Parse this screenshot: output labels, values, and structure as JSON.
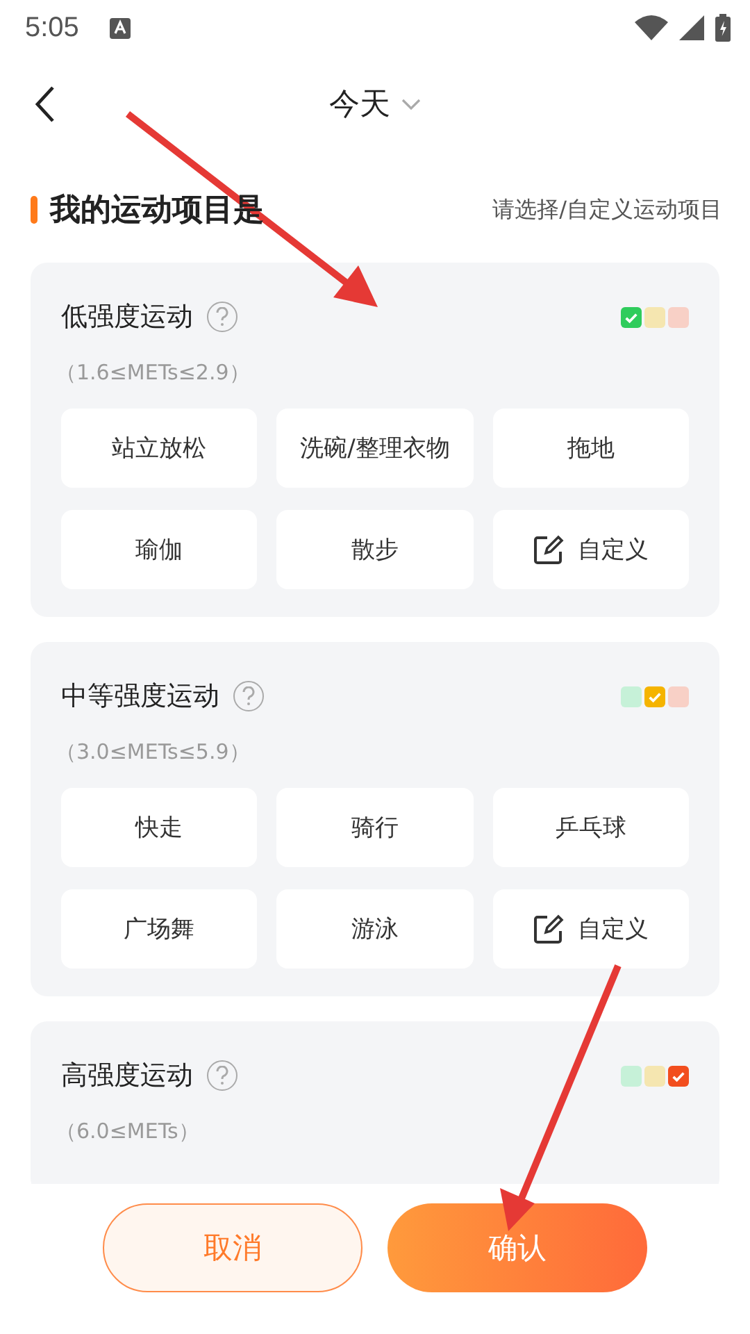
{
  "status_bar": {
    "time": "5:05"
  },
  "header": {
    "title": "今天"
  },
  "section": {
    "title": "我的运动项目是",
    "hint": "请选择/自定义运动项目"
  },
  "groups": [
    {
      "title": "低强度运动",
      "range": "（1.6≤METs≤2.9）",
      "levels": [
        {
          "color": "#2fcc5c",
          "selected": true
        },
        {
          "color": "#f5e6b0",
          "selected": false
        },
        {
          "color": "#f8d0c6",
          "selected": false
        }
      ],
      "items": [
        {
          "kind": "activity",
          "label": "站立放松"
        },
        {
          "kind": "activity",
          "label": "洗碗/整理衣物"
        },
        {
          "kind": "activity",
          "label": "拖地"
        },
        {
          "kind": "activity",
          "label": "瑜伽"
        },
        {
          "kind": "activity",
          "label": "散步"
        },
        {
          "kind": "custom",
          "label": "自定义"
        }
      ]
    },
    {
      "title": "中等强度运动",
      "range": "（3.0≤METs≤5.9）",
      "levels": [
        {
          "color": "#c6f1d8",
          "selected": false
        },
        {
          "color": "#f5b400",
          "selected": true
        },
        {
          "color": "#f8d0c6",
          "selected": false
        }
      ],
      "items": [
        {
          "kind": "activity",
          "label": "快走"
        },
        {
          "kind": "activity",
          "label": "骑行"
        },
        {
          "kind": "activity",
          "label": "乒乓球"
        },
        {
          "kind": "activity",
          "label": "广场舞"
        },
        {
          "kind": "activity",
          "label": "游泳"
        },
        {
          "kind": "custom",
          "label": "自定义"
        }
      ]
    },
    {
      "title": "高强度运动",
      "range": "（6.0≤METs）",
      "levels": [
        {
          "color": "#c6f1d8",
          "selected": false
        },
        {
          "color": "#f5e6b0",
          "selected": false
        },
        {
          "color": "#f24e1e",
          "selected": true
        }
      ]
    }
  ],
  "buttons": {
    "cancel": "取消",
    "confirm": "确认"
  }
}
